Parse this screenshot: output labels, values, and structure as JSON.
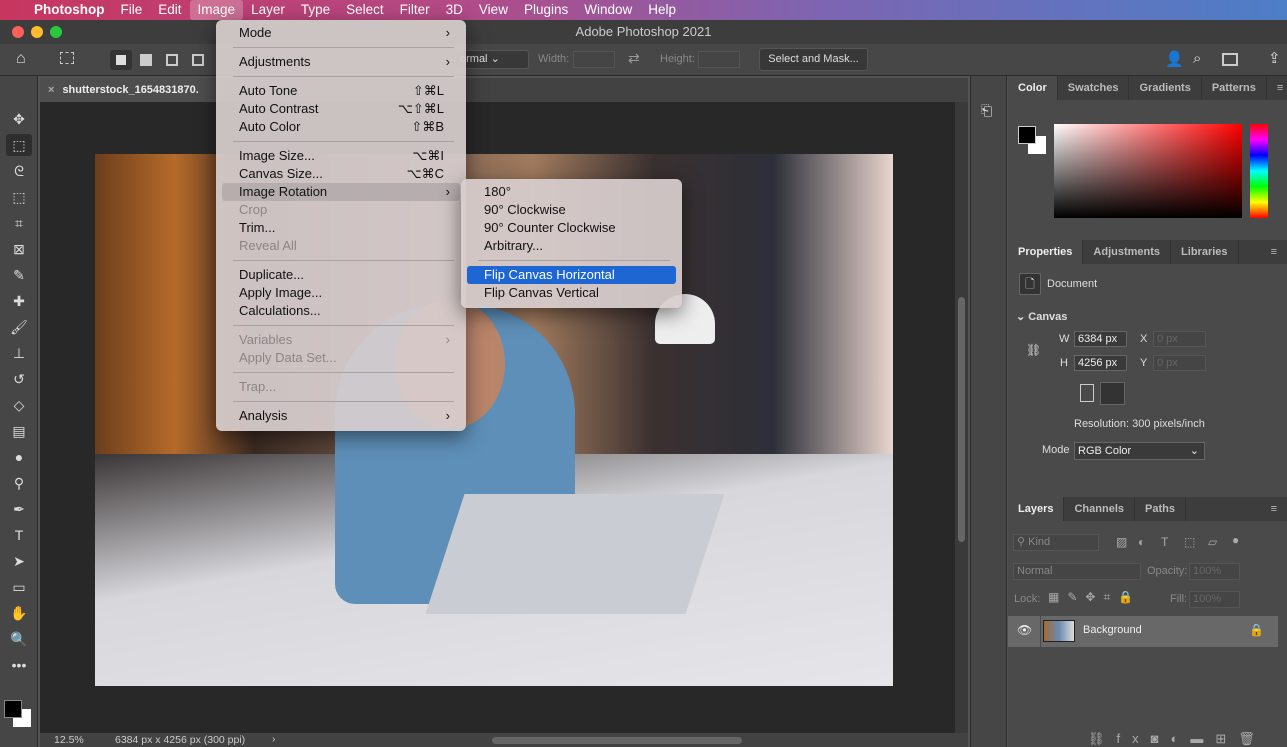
{
  "menubar": {
    "items": [
      "Photoshop",
      "File",
      "Edit",
      "Image",
      "Layer",
      "Type",
      "Select",
      "Filter",
      "3D",
      "View",
      "Plugins",
      "Window",
      "Help"
    ],
    "active": "Image"
  },
  "window": {
    "title": "Adobe Photoshop 2021"
  },
  "options": {
    "blend": "ormal",
    "width_label": "Width:",
    "height_label": "Height:",
    "select_mask": "Select and Mask..."
  },
  "document": {
    "tab": "shutterstock_1654831870."
  },
  "status": {
    "zoom": "12.5%",
    "info": "6384 px x 4256 px (300 ppi)"
  },
  "image_menu": {
    "items": [
      {
        "label": "Mode",
        "arrow": true
      },
      {
        "sep": true
      },
      {
        "label": "Adjustments",
        "arrow": true
      },
      {
        "sep": true
      },
      {
        "label": "Auto Tone",
        "shortcut": "⇧⌘L"
      },
      {
        "label": "Auto Contrast",
        "shortcut": "⌥⇧⌘L"
      },
      {
        "label": "Auto Color",
        "shortcut": "⇧⌘B"
      },
      {
        "sep": true
      },
      {
        "label": "Image Size...",
        "shortcut": "⌥⌘I"
      },
      {
        "label": "Canvas Size...",
        "shortcut": "⌥⌘C"
      },
      {
        "label": "Image Rotation",
        "arrow": true,
        "highlight": true
      },
      {
        "label": "Crop",
        "disabled": true
      },
      {
        "label": "Trim..."
      },
      {
        "label": "Reveal All",
        "disabled": true
      },
      {
        "sep": true
      },
      {
        "label": "Duplicate..."
      },
      {
        "label": "Apply Image..."
      },
      {
        "label": "Calculations..."
      },
      {
        "sep": true
      },
      {
        "label": "Variables",
        "arrow": true,
        "disabled": true
      },
      {
        "label": "Apply Data Set...",
        "disabled": true
      },
      {
        "sep": true
      },
      {
        "label": "Trap...",
        "disabled": true
      },
      {
        "sep": true
      },
      {
        "label": "Analysis",
        "arrow": true
      }
    ]
  },
  "rotation_menu": {
    "items": [
      {
        "label": "180°"
      },
      {
        "label": "90° Clockwise"
      },
      {
        "label": "90° Counter Clockwise"
      },
      {
        "label": "Arbitrary..."
      },
      {
        "sep": true
      },
      {
        "label": "Flip Canvas Horizontal",
        "selected": true
      },
      {
        "label": "Flip Canvas Vertical"
      }
    ]
  },
  "color_panel": {
    "tabs": [
      "Color",
      "Swatches",
      "Gradients",
      "Patterns"
    ],
    "active": "Color",
    "foreground": "#000000",
    "background": "#ffffff"
  },
  "properties": {
    "tabs": [
      "Properties",
      "Adjustments",
      "Libraries"
    ],
    "doc_label": "Document",
    "section": "Canvas",
    "w_label": "W",
    "w": "6384 px",
    "h_label": "H",
    "h": "4256 px",
    "x_label": "X",
    "x": "0 px",
    "y_label": "Y",
    "y": "0 px",
    "resolution": "Resolution: 300 pixels/inch",
    "mode_label": "Mode",
    "mode": "RGB Color"
  },
  "layers": {
    "tabs": [
      "Layers",
      "Channels",
      "Paths"
    ],
    "kind": "Kind",
    "blend": "Normal",
    "opacity_label": "Opacity:",
    "opacity": "100%",
    "lock_label": "Lock:",
    "fill_label": "Fill:",
    "fill": "100%",
    "items": [
      {
        "name": "Background",
        "locked": true,
        "visible": true
      }
    ]
  }
}
